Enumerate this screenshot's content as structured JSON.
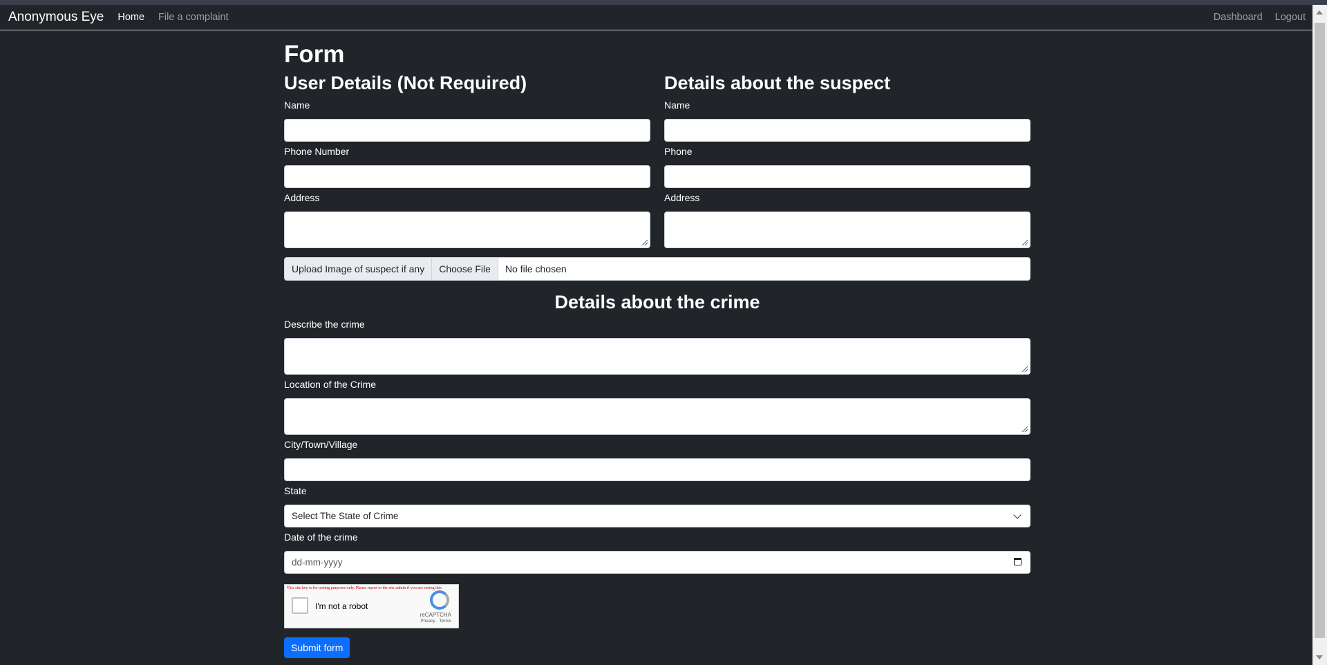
{
  "nav": {
    "brand": "Anonymous Eye",
    "home": "Home",
    "file_complaint": "File a complaint",
    "dashboard": "Dashboard",
    "logout": "Logout"
  },
  "form": {
    "title": "Form",
    "user_section": {
      "heading": "User Details (Not Required)",
      "name_label": "Name",
      "phone_label": "Phone Number",
      "address_label": "Address"
    },
    "suspect_section": {
      "heading": "Details about the suspect",
      "name_label": "Name",
      "phone_label": "Phone",
      "address_label": "Address"
    },
    "upload": {
      "label": "Upload Image of suspect if any",
      "button": "Choose File",
      "status": "No file chosen"
    },
    "crime_section": {
      "heading": "Details about the crime",
      "describe_label": "Describe the crime",
      "location_label": "Location of the Crime",
      "city_label": "City/Town/Village",
      "state_label": "State",
      "state_selected": "Select The State of Crime",
      "date_label": "Date of the crime",
      "date_placeholder": "dd-mm-yyyy"
    },
    "captcha": {
      "warning": "This site key is for testing purposes only. Please report to the site admin if you are seeing this.",
      "checkbox_label": "I'm not a robot",
      "brand": "reCAPTCHA",
      "links": "Privacy - Terms"
    },
    "submit": "Submit form"
  }
}
